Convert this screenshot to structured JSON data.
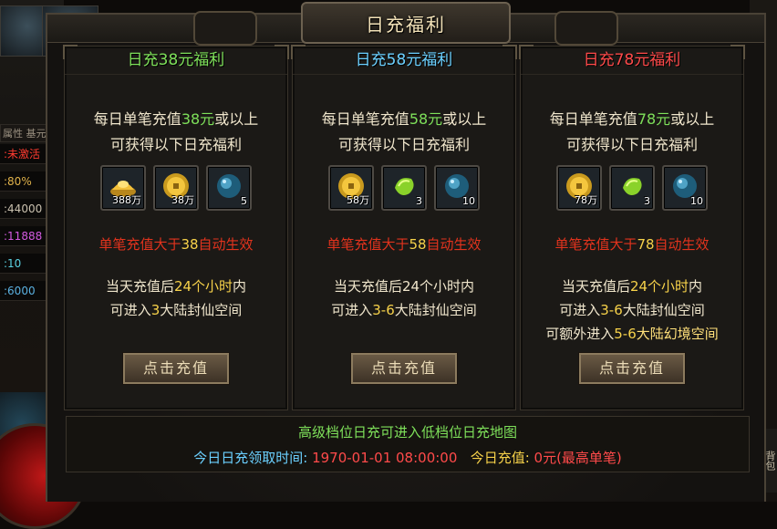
{
  "window": {
    "title": "日充福利"
  },
  "side": {
    "attr_header": "属性 基元",
    "stats": [
      {
        "text": ":未激活",
        "color": "#ff3b30"
      },
      {
        "text": ":80%",
        "color": "#e0b24a"
      },
      {
        "text": ":44000",
        "color": "#c9c0ae"
      },
      {
        "text": ":11888",
        "color": "#d35ae0"
      },
      {
        "text": ":10",
        "color": "#5ad0e0"
      },
      {
        "text": ":6000",
        "color": "#5ab0e0"
      }
    ],
    "right_label": "背包"
  },
  "panels": [
    {
      "header_prefix": "日充",
      "header_amount": "38",
      "header_suffix": "元福利",
      "header_color": "#7ee05a",
      "desc_line1_prefix": "每日单笔充值",
      "desc_line1_amount": "38元",
      "desc_line1_suffix": "或以上",
      "desc_line2": "可获得以下日充福利",
      "amount_color": "#7ee05a",
      "items": [
        {
          "icon": "gold-ingot-icon",
          "qty": "388万"
        },
        {
          "icon": "gold-coin-icon",
          "qty": "38万"
        },
        {
          "icon": "blue-orb-icon",
          "qty": "5"
        }
      ],
      "cond_prefix": "单笔充值大于",
      "cond_amount": "38",
      "cond_suffix": "自动生效",
      "time_line1_prefix": "当天充值后",
      "time_line1_hours": "24个小时",
      "time_line1_suffix": "内",
      "time_line2_prefix": "可进入",
      "time_line2_range": "3",
      "time_line2_suffix": "大陆封仙空间",
      "time_line3_prefix": "",
      "time_line3_range": "",
      "time_line3_suffix": "",
      "button": "点击充值"
    },
    {
      "header_prefix": "日充",
      "header_amount": "58",
      "header_suffix": "元福利",
      "header_color": "#6bd0ff",
      "desc_line1_prefix": "每日单笔充值",
      "desc_line1_amount": "58元",
      "desc_line1_suffix": "或以上",
      "desc_line2": "可获得以下日充福利",
      "amount_color": "#7ee05a",
      "items": [
        {
          "icon": "gold-coin-icon",
          "qty": "58万"
        },
        {
          "icon": "green-jade-icon",
          "qty": "3"
        },
        {
          "icon": "blue-orb-icon",
          "qty": "10"
        }
      ],
      "cond_prefix": "单笔充值大于",
      "cond_amount": "58",
      "cond_suffix": "自动生效",
      "time_line1_prefix": "当天充值后24个小时内",
      "time_line1_hours": "",
      "time_line1_suffix": "",
      "time_line2_prefix": "可进入",
      "time_line2_range": "3-6",
      "time_line2_suffix": "大陆封仙空间",
      "time_line3_prefix": "",
      "time_line3_range": "",
      "time_line3_suffix": "",
      "button": "点击充值"
    },
    {
      "header_prefix": "日充",
      "header_amount": "78",
      "header_suffix": "元福利",
      "header_color": "#ff4a4a",
      "desc_line1_prefix": "每日单笔充值",
      "desc_line1_amount": "78元",
      "desc_line1_suffix": "或以上",
      "desc_line2": "可获得以下日充福利",
      "amount_color": "#7ee05a",
      "items": [
        {
          "icon": "gold-coin-icon",
          "qty": "78万"
        },
        {
          "icon": "green-jade-icon",
          "qty": "3"
        },
        {
          "icon": "blue-orb-icon",
          "qty": "10"
        }
      ],
      "cond_prefix": "单笔充值大于",
      "cond_amount": "78",
      "cond_suffix": "自动生效",
      "time_line1_prefix": "当天充值后",
      "time_line1_hours": "24个小时",
      "time_line1_suffix": "内",
      "time_line2_prefix": "可进入",
      "time_line2_range": "3-6",
      "time_line2_suffix": "大陆封仙空间",
      "time_line3_prefix": "可额外进入",
      "time_line3_range": "5-6",
      "time_line3_suffix": "大陆幻境空间",
      "button": "点击充值"
    }
  ],
  "footer": {
    "line1": "高级档位日充可进入低档位日充地图",
    "time_label": "今日日充领取时间:",
    "time_value": "1970-01-01 08:00:00",
    "recharge_label": "今日充值:",
    "recharge_value": "0元(最高单笔)"
  }
}
